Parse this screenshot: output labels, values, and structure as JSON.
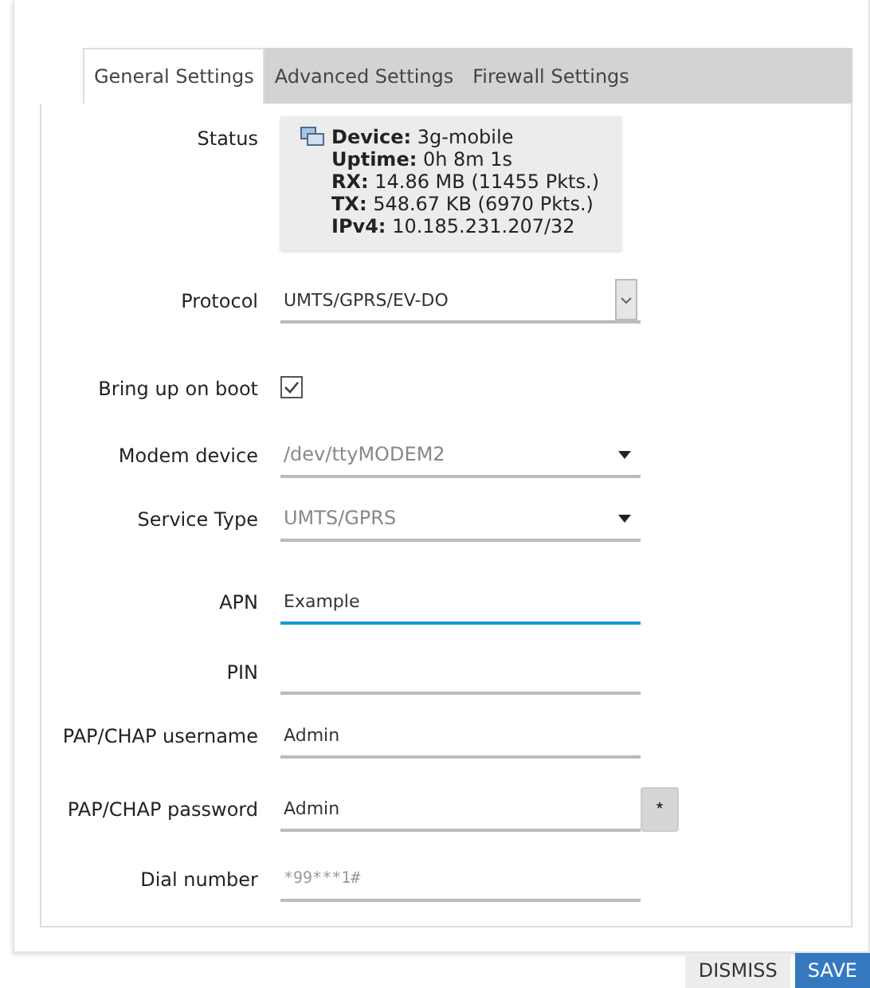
{
  "tabs": [
    {
      "label": "General Settings",
      "selected": true
    },
    {
      "label": "Advanced Settings",
      "selected": false
    },
    {
      "label": "Firewall Settings",
      "selected": false
    }
  ],
  "status": {
    "label": "Status",
    "lines": [
      {
        "name": "Device:",
        "value": "3g-mobile"
      },
      {
        "name": "Uptime:",
        "value": "0h 8m 1s"
      },
      {
        "name": "RX:",
        "value": "14.86 MB (11455 Pkts.)"
      },
      {
        "name": "TX:",
        "value": "548.67 KB (6970 Pkts.)"
      },
      {
        "name": "IPv4:",
        "value": "10.185.231.207/32"
      }
    ]
  },
  "fields": [
    {
      "kind": "select",
      "label": "Protocol",
      "value": "UMTS/GPRS/EV-DO"
    },
    {
      "kind": "checkbox",
      "label": "Bring up on boot",
      "checked": true
    },
    {
      "kind": "dropdown",
      "label": "Modem device",
      "value": "/dev/ttyMODEM2"
    },
    {
      "kind": "dropdown",
      "label": "Service Type",
      "value": "UMTS/GPRS"
    },
    {
      "kind": "text",
      "label": "APN",
      "value": "Example",
      "focused": true
    },
    {
      "kind": "text",
      "label": "PIN",
      "focused": false
    },
    {
      "kind": "text",
      "label": "PAP/CHAP username",
      "value": "Admin",
      "focused": false
    },
    {
      "kind": "password",
      "label": "PAP/CHAP password",
      "value": "Admin",
      "button": "*"
    },
    {
      "kind": "text",
      "label": "Dial number",
      "placeholder": "*99***1#",
      "focused": false
    }
  ],
  "buttons": [
    {
      "kind": "secondary",
      "label": "DISMISS"
    },
    {
      "kind": "primary",
      "label": "SAVE"
    }
  ]
}
